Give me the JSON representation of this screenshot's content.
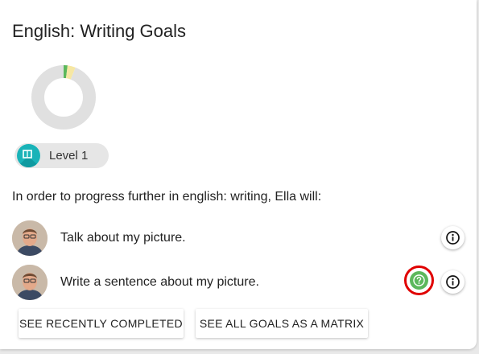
{
  "card": {
    "title": "English: Writing Goals",
    "progress_donut": {
      "segments": [
        {
          "status": "completed",
          "color": "#5cb85c",
          "fraction": 0.02
        },
        {
          "status": "in-progress",
          "color": "#f6e7a3",
          "fraction": 0.04
        },
        {
          "status": "not-started",
          "color": "#e0e0e0",
          "fraction": 0.94
        }
      ]
    },
    "level": {
      "label": "Level 1",
      "icon": "level-book-icon",
      "icon_color": "#19b3b8"
    },
    "intro": "In order to progress further in english: writing, Ella will:",
    "goals": [
      {
        "text": "Talk about my picture.",
        "avatar": "teacher-avatar",
        "actions": [
          "info-icon"
        ]
      },
      {
        "text": "Write a sentence about my picture.",
        "avatar": "teacher-avatar",
        "actions": [
          "help-icon",
          "info-icon"
        ]
      }
    ],
    "buttons": {
      "recently_completed": "SEE RECENTLY COMPLETED",
      "all_goals_matrix": "SEE ALL GOALS AS A MATRIX"
    }
  },
  "colors": {
    "help_green": "#5cb85c",
    "highlight_red": "#e00000"
  }
}
